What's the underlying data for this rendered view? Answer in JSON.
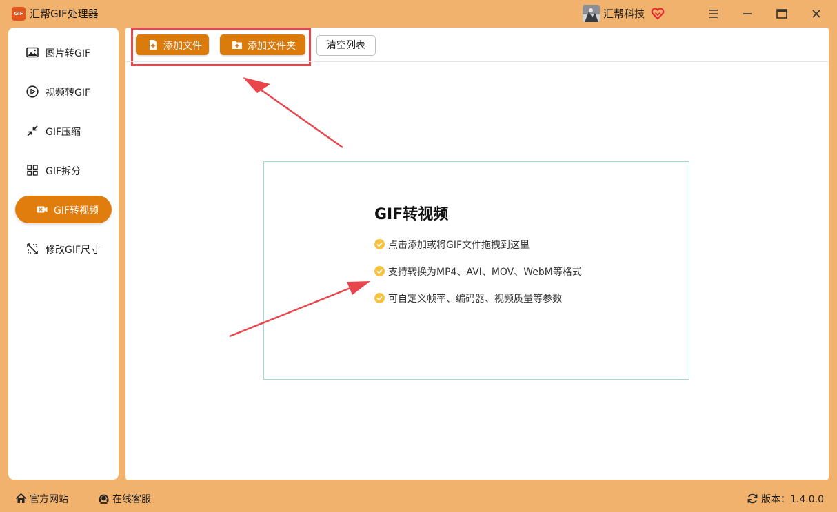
{
  "app": {
    "logo_text": "GIF",
    "title": "汇帮GIF处理器",
    "brand": "汇帮科技"
  },
  "sidebar": {
    "items": [
      {
        "label": "图片转GIF",
        "icon": "image-icon",
        "active": false
      },
      {
        "label": "视频转GIF",
        "icon": "play-circle-icon",
        "active": false
      },
      {
        "label": "GIF压缩",
        "icon": "compress-arrows-icon",
        "active": false
      },
      {
        "label": "GIF拆分",
        "icon": "split-grid-icon",
        "active": false
      },
      {
        "label": "GIF转视频",
        "icon": "video-camera-icon",
        "active": true
      },
      {
        "label": "修改GIF尺寸",
        "icon": "resize-icon",
        "active": false
      }
    ]
  },
  "toolbar": {
    "add_file_label": "添加文件",
    "add_folder_label": "添加文件夹",
    "clear_list_label": "清空列表"
  },
  "dropzone": {
    "title": "GIF转视频",
    "tips": [
      "点击添加或将GIF文件拖拽到这里",
      "支持转换为MP4、AVI、MOV、WebM等格式",
      "可自定义帧率、编码器、视频质量等参数"
    ]
  },
  "footer": {
    "website_label": "官方网站",
    "service_label": "在线客服",
    "version_label": "版本：1.4.0.0"
  },
  "colors": {
    "frame_bg": "#f0b26c",
    "accent": "#db7b0c",
    "active_nav": "#e07d0d",
    "annotation_red": "#e8464c",
    "check_yellow": "#f5c342",
    "dropzone_border": "#9cdcd2"
  }
}
